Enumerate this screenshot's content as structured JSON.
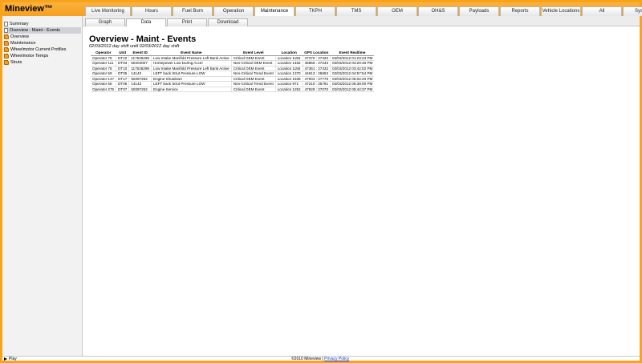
{
  "app": {
    "title": "Mineview™"
  },
  "nav": {
    "tabs": [
      {
        "label": "Live Monitoring",
        "w": 57
      },
      {
        "label": "Hours",
        "w": 50
      },
      {
        "label": "Fuel Burn",
        "w": 50
      },
      {
        "label": "Operation",
        "w": 50
      },
      {
        "label": "Maintenance",
        "w": 50,
        "active": true
      },
      {
        "label": "TKPH",
        "w": 50
      },
      {
        "label": "TMS",
        "w": 50
      },
      {
        "label": "OEM",
        "w": 50
      },
      {
        "label": "OH&S",
        "w": 50
      },
      {
        "label": "Payloads",
        "w": 50
      },
      {
        "label": "Reports",
        "w": 50
      },
      {
        "label": "Vehicle Locations",
        "w": 50
      },
      {
        "label": "All",
        "w": 50
      },
      {
        "label": "System",
        "w": 50
      }
    ]
  },
  "subnav": {
    "tabs": [
      {
        "label": "Graph",
        "w": 50
      },
      {
        "label": "Data",
        "w": 50,
        "active": true
      },
      {
        "label": "Print",
        "w": 50
      },
      {
        "label": "Download",
        "w": 50
      }
    ]
  },
  "sidebar": {
    "items": [
      {
        "label": "Summary",
        "icon": "document-icon"
      },
      {
        "label": "Overview - Maint - Events",
        "icon": "document-icon",
        "selected": true
      },
      {
        "label": "Overview",
        "icon": "folder-icon"
      },
      {
        "label": "Maintenance",
        "icon": "folder-icon"
      },
      {
        "label": "Wheelmotor Current Profiles",
        "icon": "folder-icon"
      },
      {
        "label": "Wheelmotor Temps",
        "icon": "folder-icon"
      },
      {
        "label": "Struts",
        "icon": "folder-icon"
      }
    ]
  },
  "main": {
    "title": "Overview - Maint - Events",
    "subtitle": "02/03/2012 day shift until 02/03/2012 day shift"
  },
  "table": {
    "headers": [
      "Operator",
      "Unit",
      "Event ID",
      "Event Name",
      "Event Level",
      "Location",
      "GPS Location",
      "Event Realtime"
    ],
    "rows": [
      [
        "Operator 75",
        "DT10",
        "117526299",
        "Low Intake Manifold Pressure Left Bank Active",
        "Critical OEM Event",
        "Location 1155",
        "47370 : 27420",
        "02/03/2012 01:23:23 PM"
      ],
      [
        "Operator 111",
        "DT03",
        "50404007",
        "Horsepower Low During Accel",
        "Non-Critical OEM Event",
        "Location 1462",
        "46856 : 27243",
        "02/03/2012 03:20:48 PM"
      ],
      [
        "Operator 75",
        "DT10",
        "117526299",
        "Low Intake Manifold Pressure Left Bank Active",
        "Critical OEM Event",
        "Location 1155",
        "47361 : 27432",
        "02/03/2012 03:42:02 PM"
      ],
      [
        "Operator 59",
        "DT05",
        "14143",
        "LEFT back Strut Pressure LOW",
        "Non-Critical Trend Event",
        "Location 1370",
        "44613 : 26653",
        "02/03/2012 04:57:54 PM"
      ],
      [
        "Operator 147",
        "DT17",
        "50397262",
        "Engine Shutdown",
        "Critical OEM Event",
        "Location 1535",
        "47004 : 27776",
        "02/03/2012 05:02:20 PM"
      ],
      [
        "Operator 55",
        "DT05",
        "14143",
        "LEFT back Strut Pressure LOW",
        "Non-Critical Trend Event",
        "Location 971",
        "47210 : 25791",
        "02/03/2012 05:39:00 PM"
      ],
      [
        "Operator 275",
        "DT07",
        "50397262",
        "Engine Service",
        "Critical OEM Event",
        "Location 1252",
        "47629 : 27070",
        "02/03/2012 05:44:37 PM"
      ]
    ]
  },
  "footer": {
    "play_label": "Play",
    "copyright": "©2010 Mineview |",
    "privacy_label": "Privacy Policy"
  }
}
